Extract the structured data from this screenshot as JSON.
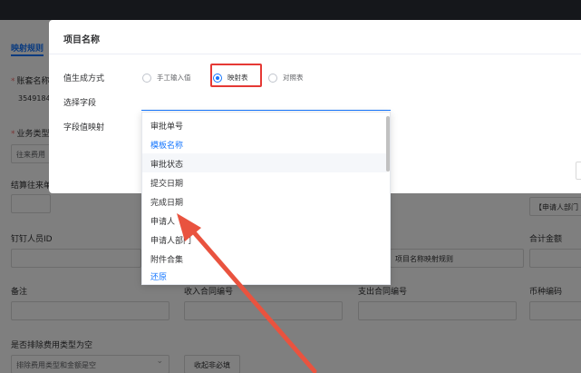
{
  "background": {
    "tab": "映射规则",
    "fields": {
      "account_code_label": "账套名称",
      "account_code_value": "35491845",
      "business_type_label": "业务类型",
      "business_type_value": "往来费用",
      "settlement_label": "结算往来单",
      "dingtalk_id_label": "钉钉人员ID",
      "total_amount_label": "合计金额",
      "remark_label": "备注",
      "income_contract_label": "收入合同编号",
      "expense_contract_label": "支出合同编号",
      "currency_code_label": "币种编码",
      "exclude_label": "是否排除费用类型为空",
      "exclude_value": "排除费用类型和金额是空",
      "applicant_dept_value": "【申请人部门",
      "mapping_rule_value": "项目名称映射规则",
      "collapse_button": "收起非必填"
    }
  },
  "modal": {
    "title": "项目名称",
    "value_source_label": "值生成方式",
    "radio_options": [
      {
        "label": "手工输入值",
        "checked": false
      },
      {
        "label": "映射表",
        "checked": true
      },
      {
        "label": "对照表",
        "checked": false
      }
    ],
    "select_field_label": "选择字段",
    "field_mapping_label": "字段值映射",
    "select_field_value": ""
  },
  "dropdown": {
    "items": [
      {
        "label": "审批单号",
        "state": "normal"
      },
      {
        "label": "模板名称",
        "state": "selected"
      },
      {
        "label": "审批状态",
        "state": "hover"
      },
      {
        "label": "提交日期",
        "state": "normal"
      },
      {
        "label": "完成日期",
        "state": "normal"
      },
      {
        "label": "申请人",
        "state": "normal"
      },
      {
        "label": "申请人部门",
        "state": "normal"
      },
      {
        "label": "附件合集",
        "state": "normal"
      }
    ],
    "restore_label": "还原"
  },
  "colors": {
    "accent": "#1677ff",
    "highlight": "#e53935",
    "arrow": "#e9533f"
  }
}
